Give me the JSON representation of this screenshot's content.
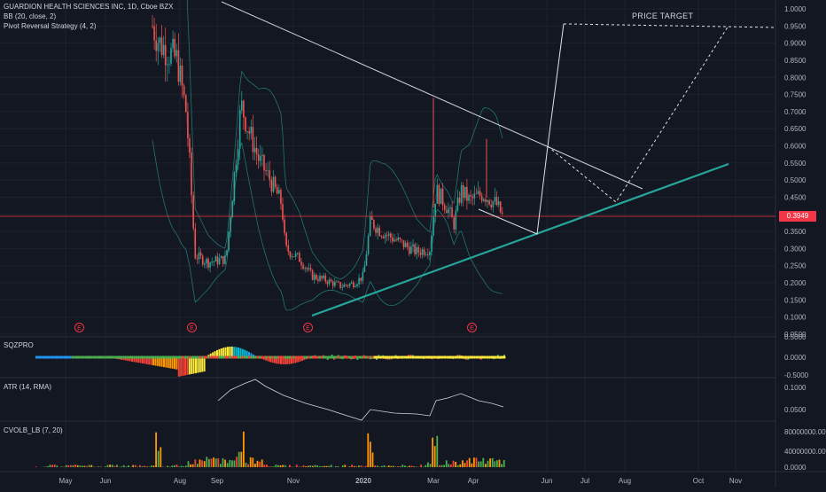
{
  "header": {
    "symbol_line": "GUARDION HEALTH SCIENCES INC, 1D, Cboe BZX",
    "indicator1": "BB (20, close, 2)",
    "indicator2": "Pivot Reversal Strategy (4, 2)"
  },
  "annotations": {
    "price_target": "PRICE TARGET",
    "earnings_marker": "E",
    "current_price": "0.3949"
  },
  "panes": {
    "sqz_label": "SQZPRO",
    "atr_label": "ATR (14, RMA)",
    "cvol_label": "CVOLB_LB (7, 20)"
  },
  "colors": {
    "background": "#131722",
    "candle_up": "#26a69a",
    "candle_down": "#ef5350",
    "bollinger": "#2a9d8f",
    "trendline_support": "#26a69a",
    "trendline_resistance": "#d1d4dc",
    "price_line": "#f23645"
  },
  "chart_data": {
    "type": "line",
    "title": "GUARDION HEALTH SCIENCES INC, 1D, Cboe BZX",
    "x_ticks": [
      "May",
      "Jun",
      "Aug",
      "Sep",
      "Nov",
      "2020",
      "Mar",
      "Apr",
      "Jun",
      "Jul",
      "Aug",
      "Oct",
      "Nov"
    ],
    "y_ticks": [
      "1.0000",
      "0.9500",
      "0.9000",
      "0.8500",
      "0.8000",
      "0.7500",
      "0.7000",
      "0.6500",
      "0.6000",
      "0.5500",
      "0.5000",
      "0.4500",
      "0.4000",
      "0.3500",
      "0.3000",
      "0.2500",
      "0.2000",
      "0.1500",
      "0.1000",
      "0.0500"
    ],
    "ylim": [
      0.05,
      1.0
    ],
    "current_price": 0.3949,
    "price_series": {
      "name": "",
      "x": [
        "Jul",
        "Jul",
        "Jul",
        "Aug",
        "Aug",
        "Aug",
        "Sep",
        "Sep",
        "Sep",
        "Sep",
        "Oct",
        "Oct",
        "Oct",
        "Nov",
        "Nov",
        "Dec",
        "Dec",
        "Jan",
        "Jan",
        "Feb",
        "Feb",
        "Mar",
        "Mar",
        "Mar",
        "Apr",
        "Apr",
        "Apr"
      ],
      "values": [
        0.95,
        0.75,
        0.55,
        0.28,
        0.26,
        0.3,
        0.65,
        0.72,
        0.55,
        0.48,
        0.45,
        0.3,
        0.26,
        0.22,
        0.19,
        0.19,
        0.21,
        0.36,
        0.34,
        0.3,
        0.29,
        0.47,
        0.42,
        0.38,
        0.5,
        0.44,
        0.3949
      ]
    },
    "trendlines": [
      {
        "label": "resistance",
        "from": {
          "x": "Jun",
          "y": 1.02
        },
        "to": {
          "x": "Aug",
          "y": 0.48
        }
      },
      {
        "label": "support",
        "from": {
          "x": "Nov",
          "y": 0.1
        },
        "to": {
          "x": "Nov",
          "y": 0.55
        }
      }
    ],
    "sqz_ticks": [
      "0.5000",
      "0.0000",
      "-0.5000"
    ],
    "atr_ticks": [
      "0.1000",
      "0.0500"
    ],
    "cvol_ticks": [
      "80000000.000",
      "40000000.000",
      "0.0000"
    ],
    "grid": true
  }
}
